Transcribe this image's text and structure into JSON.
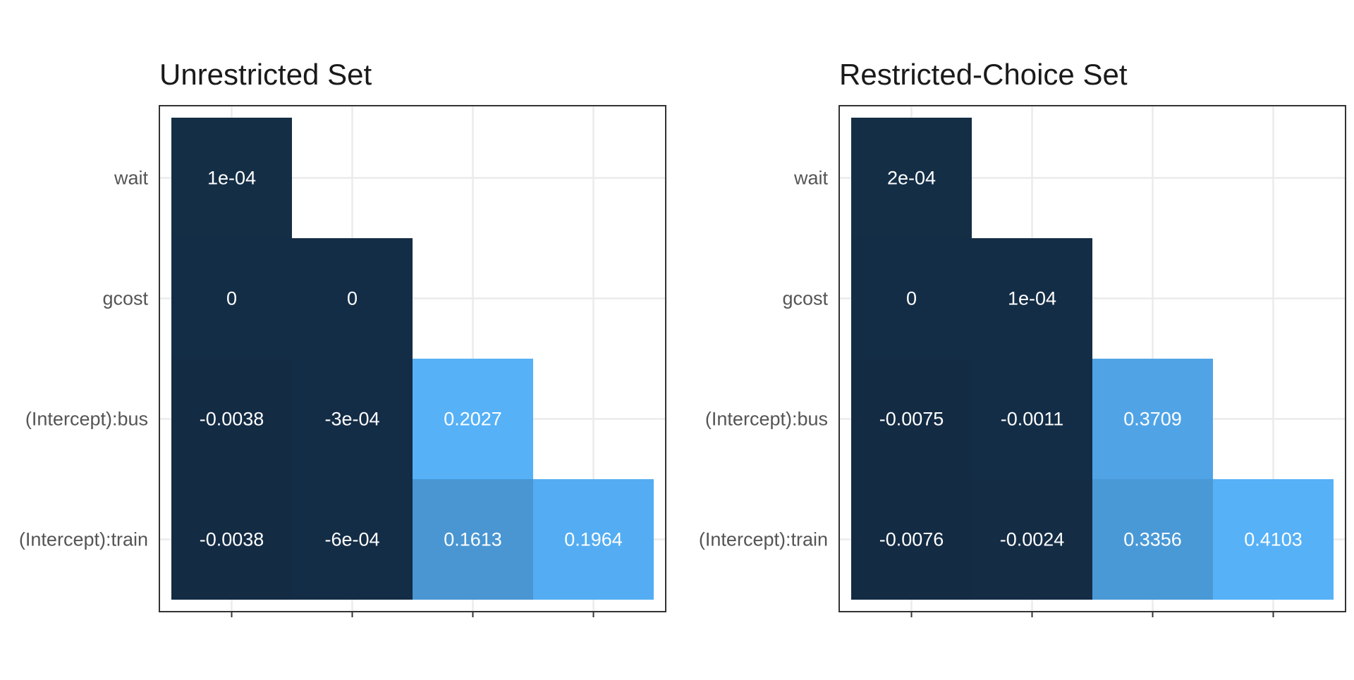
{
  "chart_data": [
    {
      "type": "heatmap",
      "title": "Unrestricted Set",
      "row_labels": [
        "wait",
        "gcost",
        "(Intercept):bus",
        "(Intercept):train"
      ],
      "col_labels": [
        "",
        "",
        "",
        ""
      ],
      "cells": [
        {
          "row": 0,
          "col": 0,
          "value": 0.0001,
          "label": "1e-04"
        },
        {
          "row": 1,
          "col": 0,
          "value": 0,
          "label": "0"
        },
        {
          "row": 1,
          "col": 1,
          "value": 0,
          "label": "0"
        },
        {
          "row": 2,
          "col": 0,
          "value": -0.0038,
          "label": "-0.0038"
        },
        {
          "row": 2,
          "col": 1,
          "value": -0.0003,
          "label": "-3e-04"
        },
        {
          "row": 2,
          "col": 2,
          "value": 0.2027,
          "label": "0.2027"
        },
        {
          "row": 3,
          "col": 0,
          "value": -0.0038,
          "label": "-0.0038"
        },
        {
          "row": 3,
          "col": 1,
          "value": -0.0006,
          "label": "-6e-04"
        },
        {
          "row": 3,
          "col": 2,
          "value": 0.1613,
          "label": "0.1613"
        },
        {
          "row": 3,
          "col": 3,
          "value": 0.1964,
          "label": "0.1964"
        }
      ],
      "grid": true,
      "legend": false
    },
    {
      "type": "heatmap",
      "title": "Restricted-Choice Set",
      "row_labels": [
        "wait",
        "gcost",
        "(Intercept):bus",
        "(Intercept):train"
      ],
      "col_labels": [
        "",
        "",
        "",
        ""
      ],
      "cells": [
        {
          "row": 0,
          "col": 0,
          "value": 0.0002,
          "label": "2e-04"
        },
        {
          "row": 1,
          "col": 0,
          "value": 0,
          "label": "0"
        },
        {
          "row": 1,
          "col": 1,
          "value": 0.0001,
          "label": "1e-04"
        },
        {
          "row": 2,
          "col": 0,
          "value": -0.0075,
          "label": "-0.0075"
        },
        {
          "row": 2,
          "col": 1,
          "value": -0.0011,
          "label": "-0.0011"
        },
        {
          "row": 2,
          "col": 2,
          "value": 0.3709,
          "label": "0.3709"
        },
        {
          "row": 3,
          "col": 0,
          "value": -0.0076,
          "label": "-0.0076"
        },
        {
          "row": 3,
          "col": 1,
          "value": -0.0024,
          "label": "-0.0024"
        },
        {
          "row": 3,
          "col": 2,
          "value": 0.3356,
          "label": "0.3356"
        },
        {
          "row": 3,
          "col": 3,
          "value": 0.4103,
          "label": "0.4103"
        }
      ],
      "grid": true,
      "legend": false
    }
  ],
  "colors": {
    "low": "#132b43",
    "high": "#56b1f7",
    "grid": "#ebebeb",
    "panel_border": "#333333",
    "background": "#ffffff"
  }
}
